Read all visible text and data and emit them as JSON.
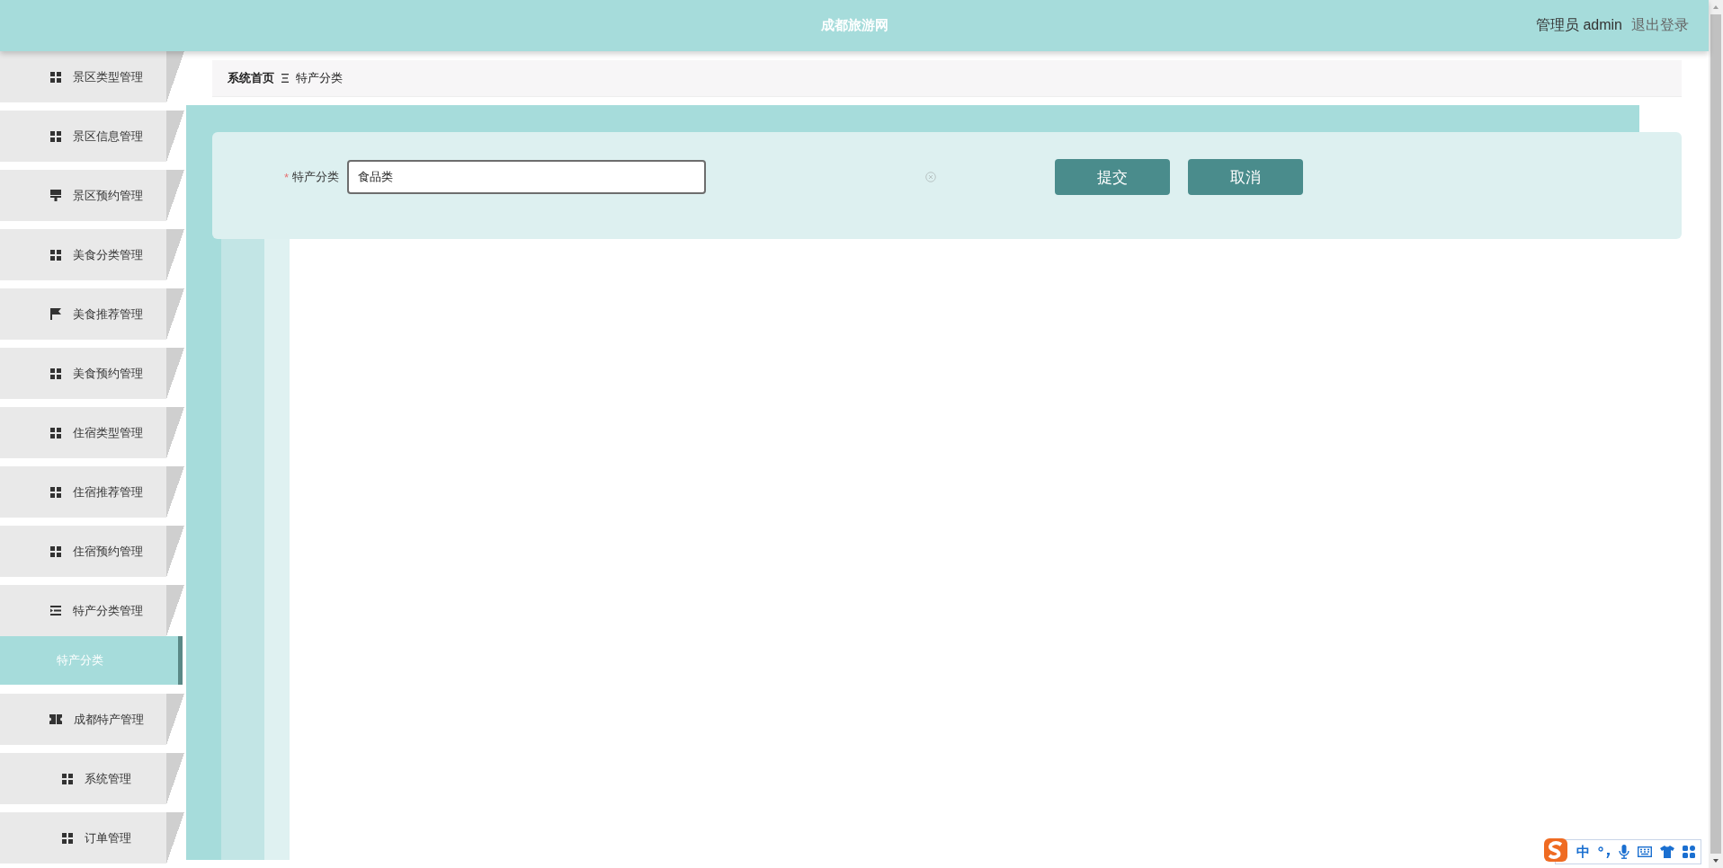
{
  "header": {
    "title": "成都旅游网",
    "user": "管理员 admin",
    "logout": "退出登录"
  },
  "sidebar": {
    "items": [
      {
        "label": "景区类型管理",
        "kind": "grid",
        "selected": false
      },
      {
        "label": "景区信息管理",
        "kind": "grid",
        "selected": false
      },
      {
        "label": "景区预约管理",
        "kind": "brush",
        "selected": false
      },
      {
        "label": "美食分类管理",
        "kind": "grid",
        "selected": false
      },
      {
        "label": "美食推荐管理",
        "kind": "flag",
        "selected": false
      },
      {
        "label": "美食预约管理",
        "kind": "grid",
        "selected": false
      },
      {
        "label": "住宿类型管理",
        "kind": "grid",
        "selected": false
      },
      {
        "label": "住宿推荐管理",
        "kind": "grid",
        "selected": false
      },
      {
        "label": "住宿预约管理",
        "kind": "grid",
        "selected": false
      },
      {
        "label": "特产分类管理",
        "kind": "list",
        "selected": false,
        "children": [
          {
            "label": "特产分类",
            "selected": true
          }
        ]
      },
      {
        "label": "成都特产管理",
        "kind": "ticket",
        "selected": false
      },
      {
        "label": "系统管理",
        "kind": "grid",
        "selected": false
      },
      {
        "label": "订单管理",
        "kind": "grid",
        "selected": false
      }
    ]
  },
  "breadcrumb": [
    "系统首页",
    "特产分类"
  ],
  "form": {
    "fields": [
      {
        "label": "特产分类",
        "required_mark": "*",
        "value": "食品类",
        "clearable": true
      }
    ],
    "buttons": [
      {
        "label": "提交"
      },
      {
        "label": "取消"
      }
    ]
  },
  "ime": {
    "mode": "中"
  }
}
